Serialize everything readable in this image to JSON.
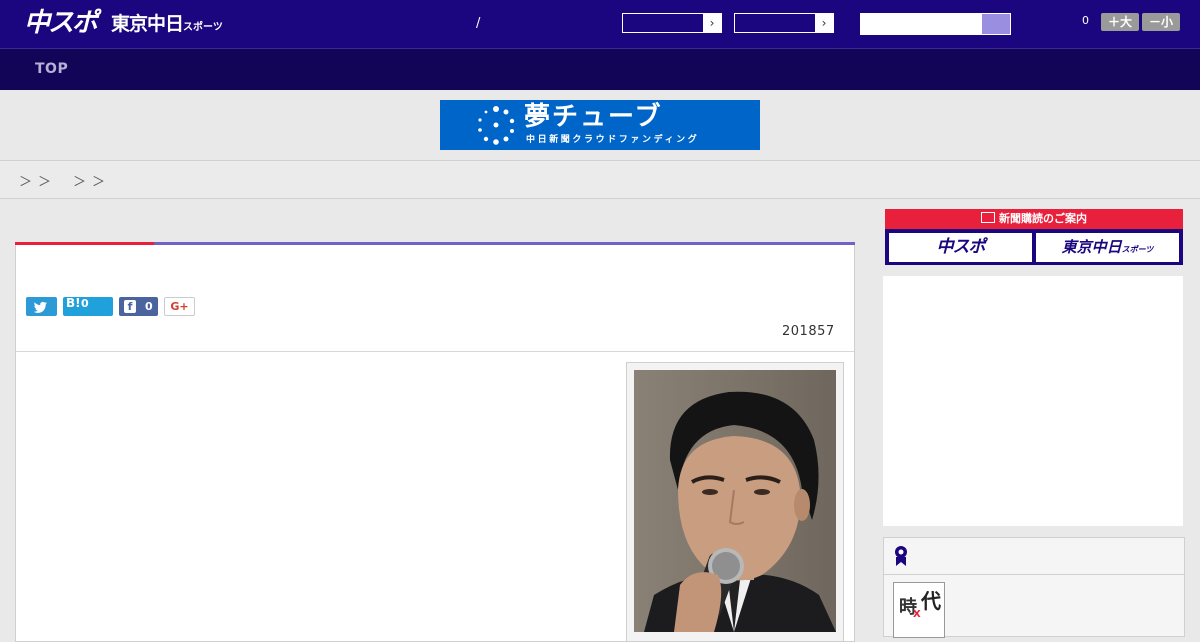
{
  "header": {
    "logo_primary": "中スポ",
    "logo_secondary_main": "東京中日",
    "logo_secondary_small": "スポーツ",
    "separator": "/",
    "counter": "0",
    "font_increase_label": "＋大",
    "font_decrease_label": "－小",
    "select_arrow": "›"
  },
  "nav": {
    "top_label": "TOP"
  },
  "banner": {
    "title": "夢チューブ",
    "subtitle": "中日新聞クラウドファンディング"
  },
  "breadcrumb": {
    "first_sep": "＞＞",
    "second_sep": "＞＞"
  },
  "article": {
    "share": {
      "twitter_icon": "twitter-icon",
      "hatena_label": "B!",
      "hatena_count": "0",
      "facebook_label": "f",
      "facebook_count": "0",
      "google_label": "G+"
    },
    "date": "201857"
  },
  "sidebar": {
    "subscription_header": "新聞購読のご案内",
    "subscription_left": "中スポ",
    "subscription_right": "東京中日",
    "subscription_right_small": "スポーツ",
    "ranking_thumb_text_1": "時",
    "ranking_thumb_text_2": "代",
    "ranking_thumb_text_3": "X"
  },
  "colors": {
    "header": "#1b067f",
    "nav": "#120558",
    "accent_red": "#e8203b",
    "accent_purple": "#7461c7",
    "banner": "#0065c8"
  }
}
